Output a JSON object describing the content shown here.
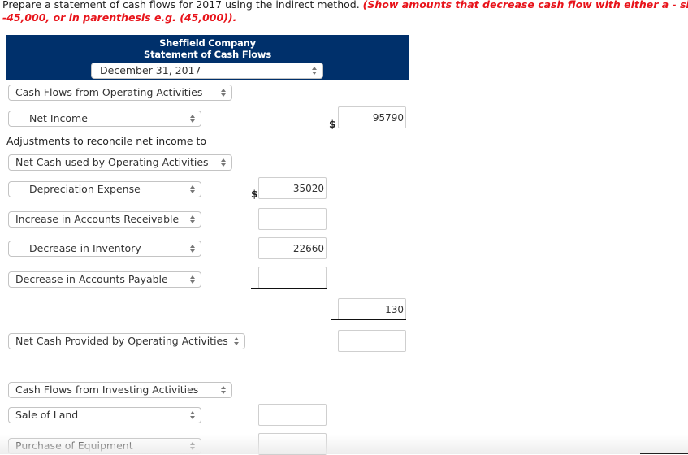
{
  "instructions": {
    "plain": "Prepare a statement of cash flows for 2017 using the indirect method. ",
    "emphasis_line1": "(Show amounts that decrease cash flow with either a - sign e",
    "emphasis_line2": "-45,000, or in parenthesis e.g. (45,000))."
  },
  "header": {
    "company": "Sheffield Company",
    "statement": "Statement of Cash Flows",
    "date_select": "December 31, 2017"
  },
  "rows": {
    "operating_heading": "Cash Flows from Operating Activities",
    "net_income_label": "Net Income",
    "net_income_value": "95790",
    "adjustments_text": "Adjustments to reconcile net income to",
    "net_cash_used_label": "Net Cash used by Operating Activities",
    "depreciation_label": "Depreciation Expense",
    "depreciation_value": "35020",
    "accounts_receivable_label": "Increase in Accounts Receivable",
    "accounts_receivable_value": "",
    "inventory_label": "Decrease in Inventory",
    "inventory_value": "22660",
    "accounts_payable_label": "Decrease in Accounts Payable",
    "accounts_payable_value": "",
    "adjustments_total_value": "130",
    "net_cash_provided_label": "Net Cash Provided by Operating Activities",
    "net_cash_provided_value": "",
    "investing_heading": "Cash Flows from Investing Activities",
    "sale_of_land_label": "Sale of Land",
    "sale_of_land_value": "",
    "purchase_equipment_label": "Purchase of Equipment",
    "purchase_equipment_value": ""
  },
  "currency_symbol": "$"
}
